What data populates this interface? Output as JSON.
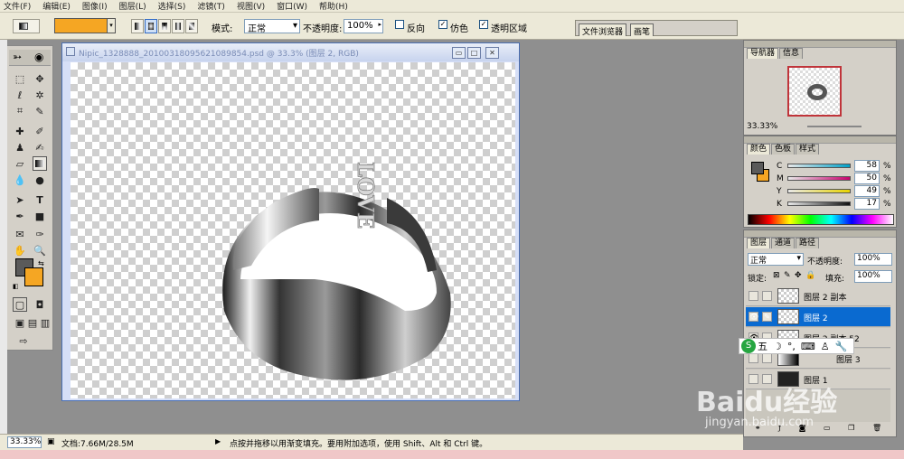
{
  "menubar": {
    "items": [
      "文件(F)",
      "编辑(E)",
      "图像(I)",
      "图层(L)",
      "选择(S)",
      "滤镜(T)",
      "视图(V)",
      "窗口(W)",
      "帮助(H)"
    ]
  },
  "options": {
    "mode_label": "模式:",
    "mode_value": "正常",
    "opacity_label": "不透明度:",
    "opacity_value": "100%",
    "reverse_label": "反向",
    "dither_label": "仿色",
    "transparency_label": "透明区域",
    "gradient_color": "#f5a623"
  },
  "palette_well": {
    "tabs": [
      "文件浏览器",
      "画笔"
    ]
  },
  "document": {
    "title": "Nipic_1328888_20100318095621089854.psd @ 33.3% (图层 2, RGB)",
    "minimize": "▭",
    "maximize": "□",
    "close": "✕",
    "love_text": "LOVE"
  },
  "navigator": {
    "tabs": [
      "导航器",
      "信息"
    ],
    "zoom": "33.33%"
  },
  "color_panel": {
    "tabs": [
      "颜色",
      "色板",
      "样式"
    ],
    "channels": [
      {
        "label": "C",
        "value": "58"
      },
      {
        "label": "M",
        "value": "50"
      },
      {
        "label": "Y",
        "value": "49"
      },
      {
        "label": "K",
        "value": "17"
      }
    ],
    "units": "%",
    "fg_color": "#5a5a5a",
    "bg_color": "#f5a623"
  },
  "layers_panel": {
    "tabs": [
      "图层",
      "通道",
      "路径"
    ],
    "blend_mode": "正常",
    "opacity_label": "不透明度:",
    "opacity_value": "100%",
    "lock_label": "锁定:",
    "fill_label": "填充:",
    "fill_value": "100%",
    "layers": [
      {
        "name": "图层 2 副本",
        "visible": false,
        "selected": false
      },
      {
        "name": "图层 2",
        "visible": true,
        "selected": true
      },
      {
        "name": "图层 2 副本 52",
        "visible": true,
        "selected": false
      },
      {
        "name": "图层 3",
        "visible": false,
        "selected": false
      },
      {
        "name": "图层 1",
        "visible": false,
        "selected": false
      }
    ]
  },
  "ime": {
    "label": "五"
  },
  "statusbar": {
    "zoom": "33.33%",
    "doc_size": "文档:7.66M/28.5M",
    "hint": "点按并拖移以用渐变填充。要用附加选项，使用 Shift、Alt 和 Ctrl 键。"
  },
  "watermark": {
    "brand": "Baidu经验",
    "url": "jingyan.baidu.com"
  }
}
